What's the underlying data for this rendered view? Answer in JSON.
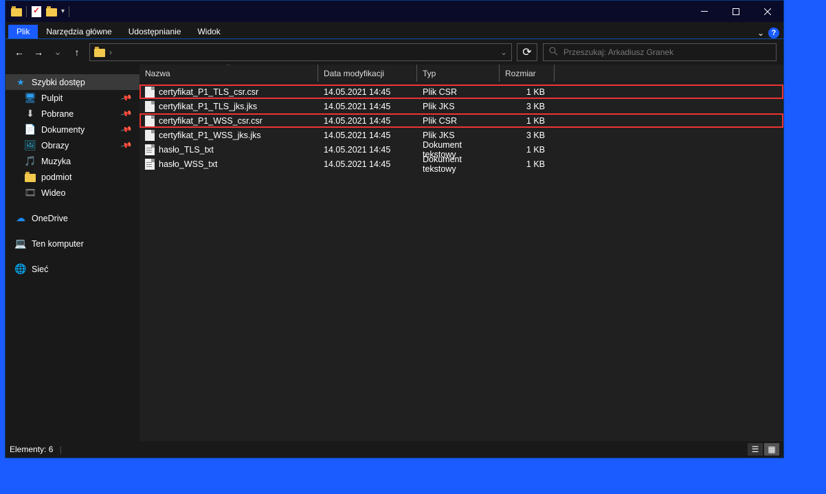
{
  "titlebar": {
    "chevron": "▾"
  },
  "tabs": {
    "file": "Plik",
    "home": "Narzędzia główne",
    "share": "Udostępnianie",
    "view": "Widok",
    "expand": "⌄"
  },
  "nav": {
    "caret": "›",
    "dropdown": "⌄",
    "refresh": "⟳"
  },
  "search": {
    "placeholder": "Przeszukaj: Arkadiusz Granek"
  },
  "sidebar": {
    "quick": "Szybki dostęp",
    "desktop": "Pulpit",
    "downloads": "Pobrane",
    "documents": "Dokumenty",
    "pictures": "Obrazy",
    "music": "Muzyka",
    "podmiot": "podmiot",
    "videos": "Wideo",
    "onedrive": "OneDrive",
    "thispc": "Ten komputer",
    "network": "Sieć"
  },
  "columns": {
    "name": "Nazwa",
    "date": "Data modyfikacji",
    "type": "Typ",
    "size": "Rozmiar"
  },
  "files": [
    {
      "name": "certyfikat_P1_TLS_csr.csr",
      "date": "14.05.2021 14:45",
      "type": "Plik CSR",
      "size": "1 KB",
      "icon": "blank",
      "hl": true
    },
    {
      "name": "certyfikat_P1_TLS_jks.jks",
      "date": "14.05.2021 14:45",
      "type": "Plik JKS",
      "size": "3 KB",
      "icon": "blank",
      "hl": false
    },
    {
      "name": "certyfikat_P1_WSS_csr.csr",
      "date": "14.05.2021 14:45",
      "type": "Plik CSR",
      "size": "1 KB",
      "icon": "blank",
      "hl": true
    },
    {
      "name": "certyfikat_P1_WSS_jks.jks",
      "date": "14.05.2021 14:45",
      "type": "Plik JKS",
      "size": "3 KB",
      "icon": "blank",
      "hl": false
    },
    {
      "name": "hasło_TLS_txt",
      "date": "14.05.2021 14:45",
      "type": "Dokument tekstowy",
      "size": "1 KB",
      "icon": "txt",
      "hl": false
    },
    {
      "name": "hasło_WSS_txt",
      "date": "14.05.2021 14:45",
      "type": "Dokument tekstowy",
      "size": "1 KB",
      "icon": "txt",
      "hl": false
    }
  ],
  "status": {
    "count": "Elementy: 6"
  }
}
